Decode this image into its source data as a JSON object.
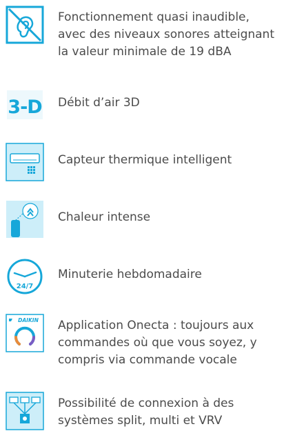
{
  "colors": {
    "accent": "#16a7d9",
    "text": "#4b4b4b"
  },
  "features": [
    {
      "icon": "quiet-ear-crossed-icon",
      "text": "Fonctionnement quasi inaudible,\navec des niveaux sonores atteignant\nla valeur minimale de 19 dBA"
    },
    {
      "icon": "3d-airflow-icon",
      "icon_label": "3-D",
      "text": "Débit d’air 3D"
    },
    {
      "icon": "intelligent-thermal-sensor-icon",
      "text": "Capteur thermique intelligent"
    },
    {
      "icon": "intense-heat-icon",
      "text": "Chaleur intense"
    },
    {
      "icon": "weekly-timer-clock-icon",
      "icon_label": "24/7",
      "text": "Minuterie hebdomadaire"
    },
    {
      "icon": "daikin-onecta-app-icon",
      "icon_label": "DAIKIN",
      "text": " Application Onecta : toujours aux\ncommandes où que vous soyez, y\ncompris via commande vocale"
    },
    {
      "icon": "network-connection-icon",
      "text": "Possibilité de connexion à des\nsystèmes split, multi et VRV"
    }
  ]
}
